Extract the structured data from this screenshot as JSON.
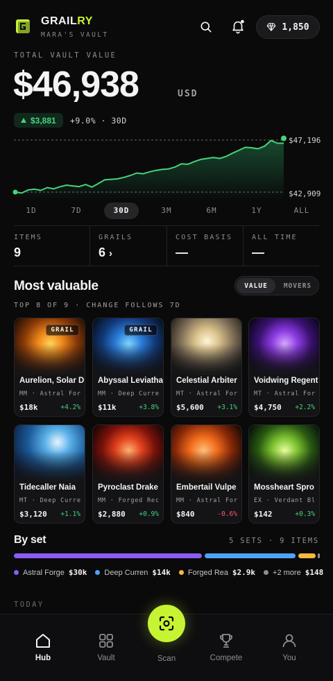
{
  "header": {
    "brand_main": "GRAIL",
    "brand_accent": "RY",
    "vault_name": "MARA'S VAULT",
    "gems": "1,850"
  },
  "summary": {
    "label": "TOTAL VAULT VALUE",
    "value": "$46,938",
    "currency": "USD",
    "delta_amount": "$3,881",
    "delta_text": "+9.0% · 30D"
  },
  "chart_data": {
    "type": "area",
    "y_max_label": "$47,196",
    "y_min_label": "$42,909",
    "ylim": [
      42909,
      47196
    ],
    "values": [
      42909,
      42830,
      43080,
      43150,
      43050,
      43280,
      43180,
      43350,
      43480,
      43420,
      43360,
      43530,
      43320,
      43620,
      43920,
      43960,
      44000,
      44120,
      44280,
      44480,
      44420,
      44580,
      44700,
      44780,
      44820,
      44980,
      45240,
      45200,
      45420,
      45600,
      45680,
      45760,
      45680,
      45860,
      46120,
      46360,
      46600,
      46560,
      46480,
      46700,
      47160,
      46938,
      46938
    ]
  },
  "ranges": [
    "1D",
    "7D",
    "30D",
    "3M",
    "6M",
    "1Y",
    "ALL"
  ],
  "selected_range": "30D",
  "stats": [
    {
      "label": "ITEMS",
      "value": "9"
    },
    {
      "label": "GRAILS",
      "value": "6",
      "chev": "›"
    },
    {
      "label": "COST BASIS",
      "value": "—"
    },
    {
      "label": "ALL TIME",
      "value": "—"
    }
  ],
  "most_valuable": {
    "title": "Most valuable",
    "toggle_value": "VALUE",
    "toggle_movers": "MOVERS",
    "subtitle": "TOP 8 OF 9 · CHANGE FOLLOWS 7D",
    "cards": [
      {
        "name": "Aurelion, Solar D",
        "meta": "MM · Astral For",
        "price": "$18k",
        "change": "+4.2%",
        "badge": "GRAIL"
      },
      {
        "name": "Abyssal Leviatha",
        "meta": "MM · Deep Curre",
        "price": "$11k",
        "change": "+3.8%",
        "badge": "GRAIL"
      },
      {
        "name": "Celestial Arbiter",
        "meta": "MT · Astral For",
        "price": "$5,600",
        "change": "+3.1%",
        "badge": ""
      },
      {
        "name": "Voidwing Regent",
        "meta": "MT · Astral For",
        "price": "$4,750",
        "change": "+2.2%",
        "badge": ""
      },
      {
        "name": "Tidecaller Naia",
        "meta": "MT · Deep Curre",
        "price": "$3,120",
        "change": "+1.1%",
        "badge": ""
      },
      {
        "name": "Pyroclast Drake",
        "meta": "MM · Forged Rec",
        "price": "$2,880",
        "change": "+0.9%",
        "badge": ""
      },
      {
        "name": "Embertail Vulpe",
        "meta": "MM · Astral For",
        "price": "$840",
        "change": "-0.6%",
        "badge": ""
      },
      {
        "name": "Mossheart Spro",
        "meta": "EX · Verdant Bl",
        "price": "$142",
        "change": "+0.3%",
        "badge": ""
      }
    ]
  },
  "by_set": {
    "title": "By set",
    "summary": "5 SETS · 9 ITEMS",
    "sets": [
      {
        "name": "Astral Forge",
        "value": "$30k",
        "color": "#8b5cf6"
      },
      {
        "name": "Deep Curren",
        "value": "$14k",
        "color": "#4fa3f7"
      },
      {
        "name": "Forged Real",
        "value": "$2.9k",
        "color": "#f5b841"
      },
      {
        "name": "+2 more",
        "value": "$148",
        "color": "#8e8e94"
      }
    ]
  },
  "today_label": "TODAY",
  "nav": [
    {
      "label": "Hub"
    },
    {
      "label": "Vault"
    },
    {
      "label": "Scan"
    },
    {
      "label": "Compete"
    },
    {
      "label": "You"
    }
  ],
  "colors": {
    "accent": "#c6f432",
    "positive": "#46d37d",
    "negative": "#ff5a6a"
  }
}
